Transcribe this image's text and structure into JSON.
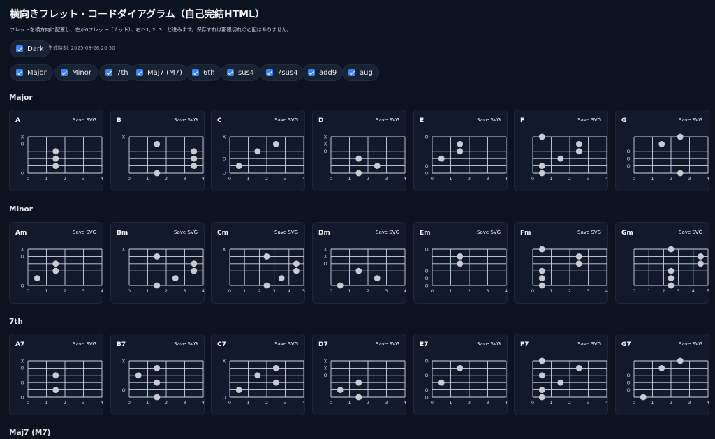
{
  "page": {
    "title": "横向きフレット・コードダイアグラム（自己完結HTML）",
    "subtitle": "フレットを横方向に配置し、左が0フレット（ナット）、右へ1, 2, 3…と進みます。保存すれば期限切れの心配はありません。",
    "dark_label": "Dark",
    "generated": "生成時刻: 2025-08-26 20:50",
    "save_label": "Save SVG"
  },
  "filters": [
    "Major",
    "Minor",
    "7th",
    "Maj7 (M7)",
    "6th",
    "sus4",
    "7sus4",
    "add9",
    "aug"
  ],
  "sections": [
    {
      "title": "Major",
      "chords": [
        {
          "name": "A",
          "frets": 4,
          "markers": [
            "X",
            "O",
            "",
            "",
            "",
            "O"
          ],
          "dots": [
            [
              2,
              1.5
            ],
            [
              3,
              1.5
            ],
            [
              4,
              1.5
            ]
          ]
        },
        {
          "name": "B",
          "frets": 4,
          "markers": [
            "X",
            "",
            "",
            "",
            "",
            ""
          ],
          "dots": [
            [
              1,
              1.5
            ],
            [
              2,
              3.5
            ],
            [
              3,
              3.5
            ],
            [
              4,
              3.5
            ],
            [
              5,
              1.5
            ]
          ]
        },
        {
          "name": "C",
          "frets": 4,
          "markers": [
            "X",
            "",
            "",
            "O",
            "",
            "O"
          ],
          "dots": [
            [
              1,
              2.5
            ],
            [
              2,
              1.5
            ],
            [
              4,
              0.5
            ]
          ]
        },
        {
          "name": "D",
          "frets": 4,
          "markers": [
            "X",
            "X",
            "O",
            "",
            "",
            ""
          ],
          "dots": [
            [
              3,
              1.5
            ],
            [
              4,
              2.5
            ],
            [
              5,
              1.5
            ]
          ]
        },
        {
          "name": "E",
          "frets": 4,
          "markers": [
            "O",
            "",
            "",
            "",
            "O",
            "O"
          ],
          "dots": [
            [
              1,
              1.5
            ],
            [
              2,
              1.5
            ],
            [
              3,
              0.5
            ]
          ]
        },
        {
          "name": "F",
          "frets": 4,
          "markers": [
            "",
            "",
            "",
            "",
            "",
            ""
          ],
          "dots": [
            [
              0,
              0.5
            ],
            [
              1,
              2.5
            ],
            [
              2,
              2.5
            ],
            [
              3,
              1.5
            ],
            [
              4,
              0.5
            ],
            [
              5,
              0.5
            ]
          ]
        },
        {
          "name": "G",
          "frets": 4,
          "markers": [
            "",
            "",
            "O",
            "O",
            "O",
            ""
          ],
          "dots": [
            [
              0,
              2.5
            ],
            [
              1,
              1.5
            ],
            [
              5,
              2.5
            ]
          ]
        }
      ]
    },
    {
      "title": "Minor",
      "chords": [
        {
          "name": "Am",
          "frets": 4,
          "markers": [
            "X",
            "O",
            "",
            "",
            "",
            "O"
          ],
          "dots": [
            [
              2,
              1.5
            ],
            [
              3,
              1.5
            ],
            [
              4,
              0.5
            ]
          ]
        },
        {
          "name": "Bm",
          "frets": 4,
          "markers": [
            "X",
            "",
            "",
            "",
            "",
            ""
          ],
          "dots": [
            [
              1,
              1.5
            ],
            [
              2,
              3.5
            ],
            [
              3,
              3.5
            ],
            [
              4,
              2.5
            ],
            [
              5,
              1.5
            ]
          ]
        },
        {
          "name": "Cm",
          "frets": 5,
          "markers": [
            "X",
            "",
            "",
            "",
            "",
            ""
          ],
          "dots": [
            [
              1,
              2.5
            ],
            [
              2,
              4.5
            ],
            [
              3,
              4.5
            ],
            [
              4,
              3.5
            ],
            [
              5,
              2.5
            ]
          ]
        },
        {
          "name": "Dm",
          "frets": 4,
          "markers": [
            "X",
            "X",
            "O",
            "",
            "",
            ""
          ],
          "dots": [
            [
              3,
              1.5
            ],
            [
              4,
              2.5
            ],
            [
              5,
              0.5
            ]
          ]
        },
        {
          "name": "Em",
          "frets": 4,
          "markers": [
            "O",
            "",
            "",
            "O",
            "O",
            "O"
          ],
          "dots": [
            [
              1,
              1.5
            ],
            [
              2,
              1.5
            ]
          ]
        },
        {
          "name": "Fm",
          "frets": 4,
          "markers": [
            "",
            "",
            "",
            "",
            "",
            ""
          ],
          "dots": [
            [
              0,
              0.5
            ],
            [
              1,
              2.5
            ],
            [
              2,
              2.5
            ],
            [
              3,
              0.5
            ],
            [
              4,
              0.5
            ],
            [
              5,
              0.5
            ]
          ]
        },
        {
          "name": "Gm",
          "frets": 5,
          "markers": [
            "",
            "",
            "",
            "",
            "",
            ""
          ],
          "dots": [
            [
              0,
              2.5
            ],
            [
              1,
              4.5
            ],
            [
              2,
              4.5
            ],
            [
              3,
              2.5
            ],
            [
              4,
              2.5
            ],
            [
              5,
              2.5
            ]
          ]
        }
      ]
    },
    {
      "title": "7th",
      "chords": [
        {
          "name": "A7",
          "frets": 4,
          "markers": [
            "X",
            "O",
            "",
            "O",
            "",
            "O"
          ],
          "dots": [
            [
              2,
              1.5
            ],
            [
              4,
              1.5
            ]
          ]
        },
        {
          "name": "B7",
          "frets": 4,
          "markers": [
            "X",
            "",
            "",
            "",
            "O",
            ""
          ],
          "dots": [
            [
              1,
              1.5
            ],
            [
              2,
              0.5
            ],
            [
              3,
              1.5
            ],
            [
              5,
              1.5
            ]
          ]
        },
        {
          "name": "C7",
          "frets": 4,
          "markers": [
            "X",
            "",
            "",
            "",
            "",
            "O"
          ],
          "dots": [
            [
              1,
              2.5
            ],
            [
              2,
              1.5
            ],
            [
              3,
              2.5
            ],
            [
              4,
              0.5
            ]
          ]
        },
        {
          "name": "D7",
          "frets": 4,
          "markers": [
            "X",
            "X",
            "O",
            "",
            "",
            ""
          ],
          "dots": [
            [
              3,
              1.5
            ],
            [
              4,
              0.5
            ],
            [
              5,
              1.5
            ]
          ]
        },
        {
          "name": "E7",
          "frets": 4,
          "markers": [
            "O",
            "",
            "O",
            "",
            "O",
            "O"
          ],
          "dots": [
            [
              1,
              1.5
            ],
            [
              3,
              0.5
            ]
          ]
        },
        {
          "name": "F7",
          "frets": 4,
          "markers": [
            "",
            "",
            "",
            "",
            "",
            ""
          ],
          "dots": [
            [
              0,
              0.5
            ],
            [
              1,
              2.5
            ],
            [
              2,
              0.5
            ],
            [
              3,
              1.5
            ],
            [
              4,
              0.5
            ],
            [
              5,
              0.5
            ]
          ]
        },
        {
          "name": "G7",
          "frets": 4,
          "markers": [
            "",
            "",
            "O",
            "O",
            "O",
            ""
          ],
          "dots": [
            [
              0,
              2.5
            ],
            [
              1,
              1.5
            ],
            [
              5,
              0.5
            ]
          ]
        }
      ]
    },
    {
      "title": "Maj7 (M7)",
      "chords": []
    }
  ]
}
